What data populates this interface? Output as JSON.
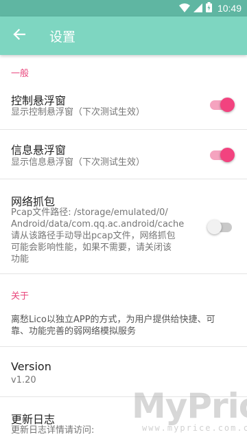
{
  "status_bar": {
    "time": "10:49",
    "icons": [
      "wifi-icon",
      "signal-icon",
      "battery-icon"
    ]
  },
  "app_bar": {
    "title": "设置",
    "back_icon": "arrow-back-icon"
  },
  "colors": {
    "app_bar": "#7ed6c1",
    "status_bar": "#5fb6a2",
    "accent": "#f2437f",
    "category": "#e8467c"
  },
  "sections": {
    "general": {
      "header": "一般",
      "float_window": {
        "title": "控制悬浮窗",
        "summary": "显示控制悬浮窗（下次测试生效）",
        "enabled": true
      },
      "info_window": {
        "title": "信息悬浮窗",
        "summary": "显示信息悬浮窗（下次测试生效）",
        "enabled": true
      },
      "packet_capture": {
        "title": "网络抓包",
        "summary_lines": [
          "Pcap文件路径: /storage/emulated/0/",
          "Android/data/com.qq.ac.android/cache",
          "请从该路径手动导出pcap文件，网络抓包",
          "可能会影响性能，如果不需要，请关闭该",
          "功能"
        ],
        "enabled": false
      }
    },
    "about": {
      "header": "关于",
      "description_lines": [
        "离愁Lico以独立APP的方式，为用户提供给快捷、可",
        "靠、功能完善的弱网络模拟服务"
      ],
      "version": {
        "title": "Version",
        "value": "v1.20"
      },
      "changelog": {
        "title": "更新日志",
        "summary": "更新日志详情请访问:"
      }
    }
  },
  "watermark": {
    "text": "MyPrice",
    "sub": "www.myprice.com.cn"
  }
}
